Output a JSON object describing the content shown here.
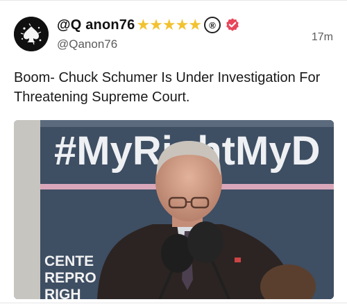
{
  "post": {
    "display_name": "@Q anon76",
    "stars": "★★★★★",
    "registered_mark": "®",
    "handle": "@Qanon76",
    "timestamp": "17m",
    "text": "Boom- Chuck Schumer Is Under Investigation For Threatening Supreme Court.",
    "media": {
      "banner_text": "#MyRightMyD",
      "banner_lower_text_1": "CENTE",
      "banner_lower_text_2": "REPRO",
      "banner_lower_text_3": "RIGH"
    }
  },
  "colors": {
    "star": "#f2c230",
    "verified": "#e8465b",
    "banner": "#3e4e63"
  },
  "icons": {
    "avatar": "spade-splash-avatar",
    "verified": "verified-check-badge"
  }
}
